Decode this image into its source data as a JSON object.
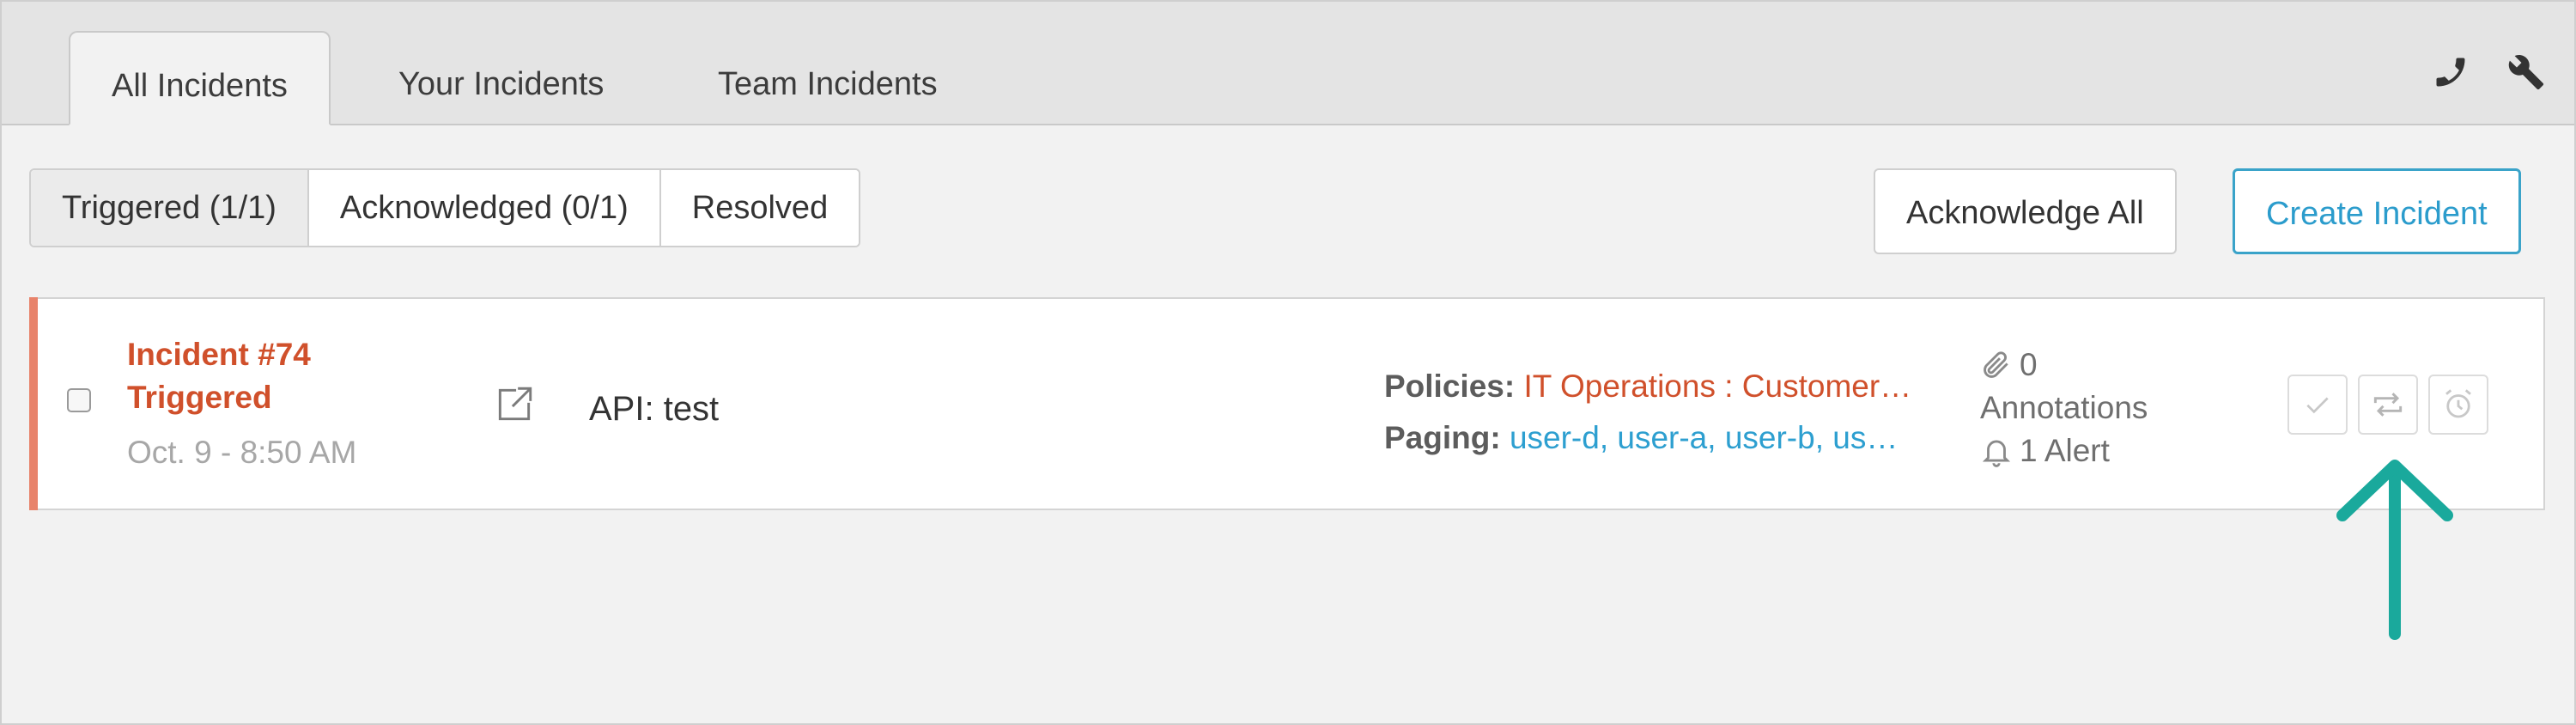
{
  "tabs": [
    {
      "label": "All Incidents",
      "active": true
    },
    {
      "label": "Your Incidents",
      "active": false
    },
    {
      "label": "Team Incidents",
      "active": false
    }
  ],
  "toolbar_icons": [
    "phone-icon",
    "wrench-icon"
  ],
  "filters": [
    {
      "label": "Triggered (1/1)",
      "active": true
    },
    {
      "label": "Acknowledged (0/1)",
      "active": false
    },
    {
      "label": "Resolved",
      "active": false
    }
  ],
  "buttons": {
    "acknowledge_all": "Acknowledge All",
    "create_incident": "Create Incident"
  },
  "incident": {
    "title": "Incident #74",
    "status": "Triggered",
    "time": "Oct. 9 - 8:50 AM",
    "summary": "API: test",
    "policies_label": "Policies:",
    "policies_value": "IT Operations : Customer…",
    "paging_label": "Paging:",
    "paging_value": "user-d, user-a, user-b, us…",
    "annotation_count": "0",
    "annotations_label": "Annotations",
    "alerts_label": "1 Alert",
    "actions": [
      "acknowledge-icon",
      "reassign-icon",
      "snooze-icon"
    ]
  },
  "colors": {
    "accent_triggered": "#d0502b",
    "stripe": "#e8836b",
    "link_blue": "#2d9fd0",
    "annotation_arrow": "#1aa99c"
  }
}
